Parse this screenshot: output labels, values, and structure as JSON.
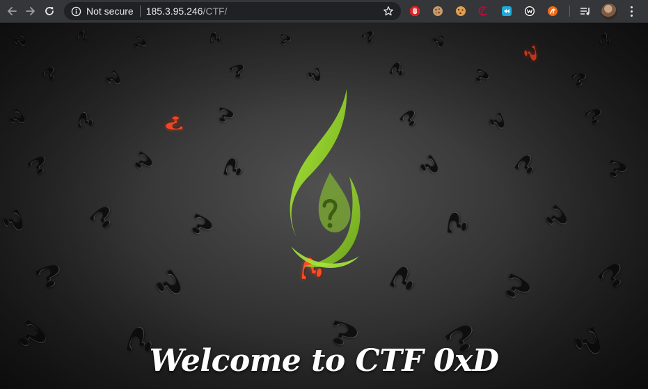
{
  "browser": {
    "security_label": "Not secure",
    "url_host": "185.3.95.246",
    "url_path": "/CTF/",
    "icons": {
      "back": "arrow-left-icon",
      "forward": "arrow-right-icon",
      "reload": "reload-icon",
      "info": "info-icon",
      "bookmark": "star-icon",
      "menu": "more-vertical-icon"
    },
    "extensions": [
      "adblock-icon",
      "cookie-icon",
      "cookie-editor-icon",
      "debian-icon",
      "screen-capture-icon",
      "wappalyzer-icon",
      "burp-proxy-icon",
      "media-control-icon"
    ]
  },
  "page": {
    "welcome_text": "Welcome to CTF 0xD",
    "colors": {
      "logo_green": "#8fd62a",
      "accent_red": "#ff4a24",
      "background": "#2b2b2b"
    }
  }
}
